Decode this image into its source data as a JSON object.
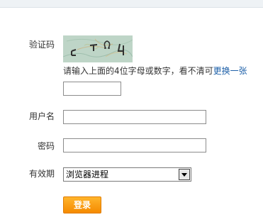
{
  "form": {
    "captcha_label": "验证码",
    "captcha_image_text": "CTΩ4",
    "captcha_hint": "请输入上面的4位字母或数字，看不清可",
    "captcha_refresh_link": "更换一张",
    "captcha_input_value": "",
    "username_label": "用户名",
    "username_value": "",
    "password_label": "密码",
    "password_value": "",
    "validity_label": "有效期",
    "validity_selected": "浏览器进程",
    "login_button": "登录"
  },
  "colors": {
    "accent": "#f59a00",
    "link": "#1c5fa8",
    "captcha_bg": "#bed5c7"
  }
}
